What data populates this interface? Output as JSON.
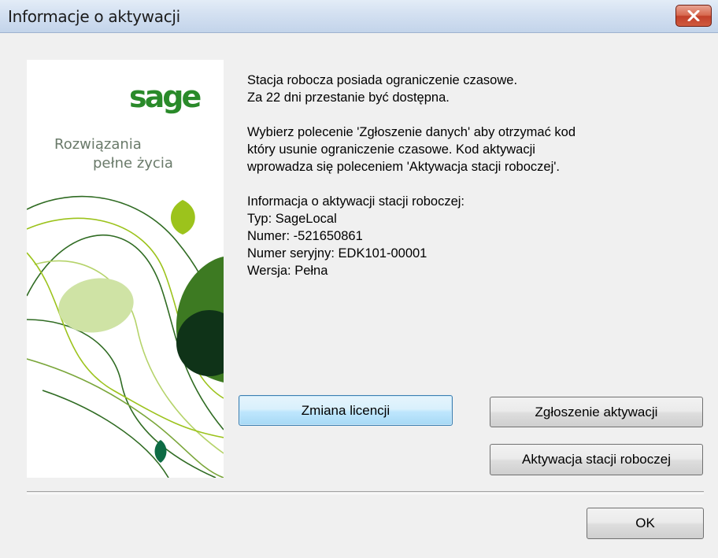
{
  "window": {
    "title": "Informacje o aktywacji"
  },
  "branding": {
    "logo_text": "sage",
    "tagline_line1": "Rozwiązania",
    "tagline_line2": "pełne życia"
  },
  "message": {
    "paragraph1": [
      "Stacja robocza posiada ograniczenie czasowe.",
      "Za 22 dni przestanie być dostępna."
    ],
    "paragraph2": [
      "Wybierz polecenie 'Zgłoszenie danych' aby otrzymać kod",
      "który usunie ograniczenie czasowe. Kod aktywacji",
      "wprowadza się poleceniem 'Aktywacja stacji roboczej'."
    ],
    "paragraph3": [
      "Informacja o aktywacji stacji roboczej:",
      "Typ: SageLocal",
      "Numer: -521650861",
      "Numer seryjny: EDK101-00001",
      "Wersja: Pełna"
    ]
  },
  "buttons": {
    "change_license": "Zmiana licencji",
    "activation_request": "Zgłoszenie aktywacji",
    "activate_workstation": "Aktywacja stacji roboczej",
    "ok": "OK"
  },
  "colors": {
    "brand_green": "#2a8a2a",
    "light_green": "#9cc31c",
    "dark_green": "#3d7a22",
    "deep_green": "#0f3318",
    "pale_green": "#cfe3a5"
  }
}
